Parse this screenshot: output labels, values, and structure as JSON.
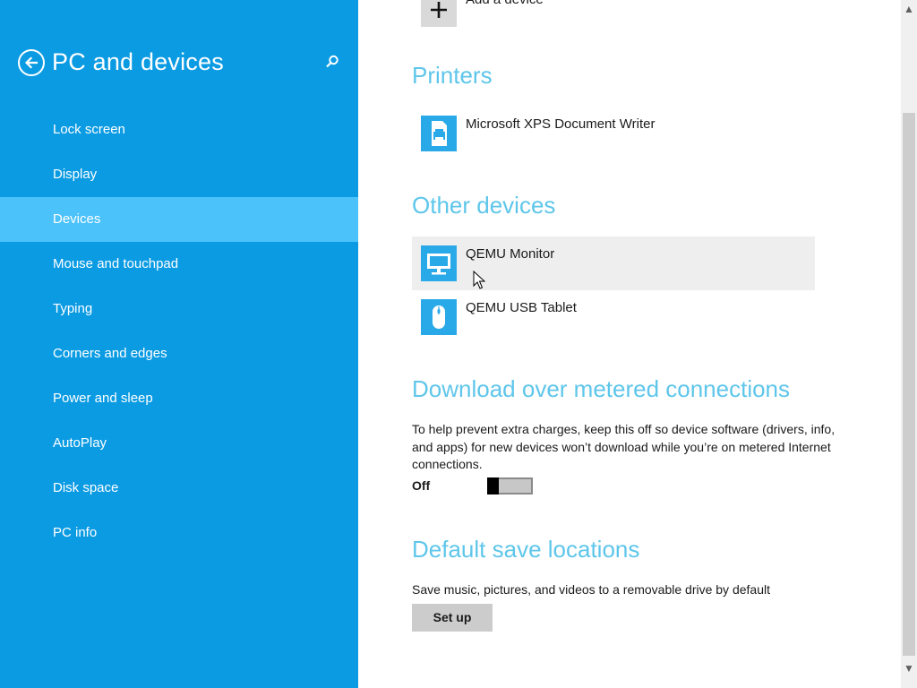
{
  "left_pane": {
    "title": "PC and devices",
    "back_icon": "back-arrow-icon",
    "search_icon": "search-icon",
    "nav": [
      {
        "label": "Lock screen",
        "selected": false
      },
      {
        "label": "Display",
        "selected": false
      },
      {
        "label": "Devices",
        "selected": true
      },
      {
        "label": "Mouse and touchpad",
        "selected": false
      },
      {
        "label": "Typing",
        "selected": false
      },
      {
        "label": "Corners and edges",
        "selected": false
      },
      {
        "label": "Power and sleep",
        "selected": false
      },
      {
        "label": "AutoPlay",
        "selected": false
      },
      {
        "label": "Disk space",
        "selected": false
      },
      {
        "label": "PC info",
        "selected": false
      }
    ]
  },
  "add_device": {
    "label": "Add a device",
    "icon": "plus-icon"
  },
  "printers": {
    "title": "Printers",
    "items": [
      {
        "name": "Microsoft XPS Document Writer",
        "icon": "printer-icon"
      }
    ]
  },
  "other_devices": {
    "title": "Other devices",
    "items": [
      {
        "name": "QEMU Monitor",
        "icon": "monitor-icon"
      },
      {
        "name": "QEMU USB Tablet",
        "icon": "mouse-icon"
      }
    ]
  },
  "metered": {
    "title": "Download over metered connections",
    "description": "To help prevent extra charges, keep this off so device software (drivers, info, and apps) for new devices won’t download while you’re on metered Internet connections.",
    "toggle_label": "Off",
    "toggle_on": false
  },
  "save_locations": {
    "title": "Default save locations",
    "description": "Save music, pictures, and videos to a removable drive by default",
    "button_label": "Set up"
  },
  "colors": {
    "left_pane_bg": "#0b9be3",
    "selected_bg": "#4cc2fb",
    "section_title": "#5ec6ea",
    "device_icon_bg": "#29a9e8"
  }
}
